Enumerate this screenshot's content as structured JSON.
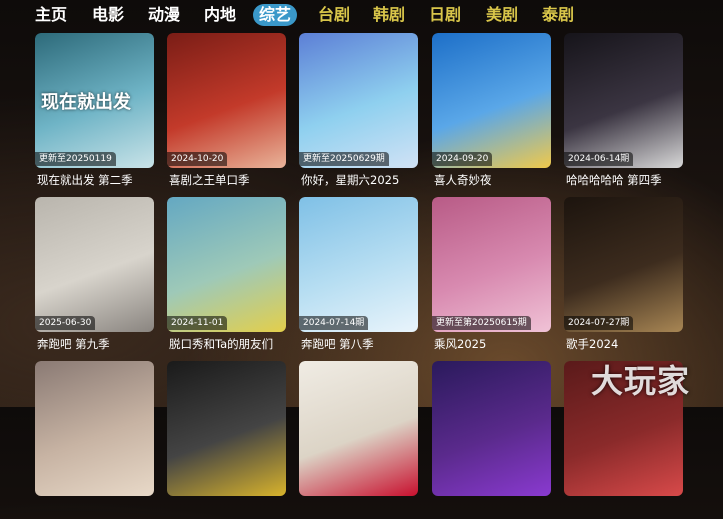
{
  "nav": {
    "items": [
      {
        "label": "主页",
        "style": "bright"
      },
      {
        "label": "电影",
        "style": "bright"
      },
      {
        "label": "动漫",
        "style": "bright"
      },
      {
        "label": "内地",
        "style": "bright"
      },
      {
        "label": "综艺",
        "style": "active"
      },
      {
        "label": "台剧",
        "style": "dim"
      },
      {
        "label": "韩剧",
        "style": "dim"
      },
      {
        "label": "日剧",
        "style": "dim"
      },
      {
        "label": "美剧",
        "style": "dim"
      },
      {
        "label": "泰剧",
        "style": "dim"
      }
    ]
  },
  "cards": [
    {
      "badge": "更新至20250119",
      "title": "现在就出发 第二季",
      "poster_text": "现在就出发",
      "colors": [
        "#2d6a7a",
        "#6fb4c6",
        "#c9e3e8"
      ]
    },
    {
      "badge": "2024-10-20",
      "title": "喜剧之王单口季",
      "poster_text": "",
      "colors": [
        "#7a1d16",
        "#c33a2a",
        "#e9b49a"
      ]
    },
    {
      "badge": "更新至20250629期",
      "title": "你好，星期六2025",
      "poster_text": "",
      "colors": [
        "#5c7fd6",
        "#8fd0ef",
        "#d1e2f5"
      ]
    },
    {
      "badge": "2024-09-20",
      "title": "喜人奇妙夜",
      "poster_text": "",
      "colors": [
        "#1d6fc8",
        "#5aa7e8",
        "#f0c94b"
      ]
    },
    {
      "badge": "2024-06-14期",
      "title": "哈哈哈哈哈 第四季",
      "poster_text": "",
      "colors": [
        "#16141a",
        "#3b3542",
        "#d9d9d9"
      ]
    },
    {
      "badge": "2025-06-30",
      "title": "奔跑吧 第九季",
      "poster_text": "",
      "colors": [
        "#b9b5ad",
        "#d8d4cc",
        "#8a8580"
      ]
    },
    {
      "badge": "2024-11-01",
      "title": "脱口秀和Ta的朋友们",
      "poster_text": "",
      "colors": [
        "#64a8c2",
        "#9ec9b8",
        "#e3cf4b"
      ]
    },
    {
      "badge": "2024-07-14期",
      "title": "奔跑吧 第八季",
      "poster_text": "",
      "colors": [
        "#7fc0e6",
        "#b7def2",
        "#e9f4fb"
      ]
    },
    {
      "badge": "更新至第20250615期",
      "title": "乘风2025",
      "poster_text": "",
      "colors": [
        "#b85b86",
        "#d88ab0",
        "#f0c2d6"
      ]
    },
    {
      "badge": "2024-07-27期",
      "title": "歌手2024",
      "poster_text": "",
      "colors": [
        "#1c140e",
        "#3d2c1e",
        "#a88654"
      ]
    },
    {
      "badge": "",
      "title": "",
      "poster_text": "",
      "colors": [
        "#8a7a74",
        "#c7b3a3",
        "#e8d9c8"
      ]
    },
    {
      "badge": "",
      "title": "",
      "poster_text": "",
      "colors": [
        "#1a1a1a",
        "#444",
        "#d8b32c"
      ]
    },
    {
      "badge": "",
      "title": "",
      "poster_text": "",
      "colors": [
        "#f0ece4",
        "#dcd4c6",
        "#c8102e"
      ]
    },
    {
      "badge": "",
      "title": "",
      "poster_text": "",
      "colors": [
        "#2a1a5c",
        "#5a2a8c",
        "#8a3ad0"
      ]
    },
    {
      "badge": "",
      "title": "",
      "poster_text": "",
      "colors": [
        "#5a1a1a",
        "#8a2a2a",
        "#d84a4a"
      ]
    }
  ],
  "watermark": "大玩家"
}
